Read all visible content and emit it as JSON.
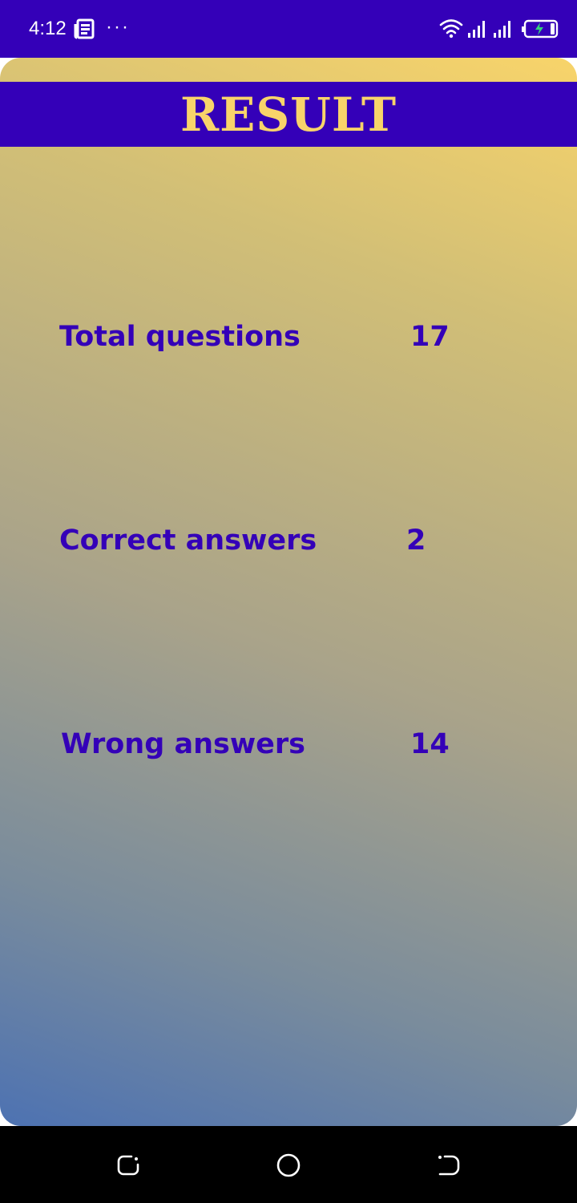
{
  "status_bar": {
    "time": "4:12",
    "icons": [
      "news-icon",
      "more-dots-icon",
      "wifi-icon",
      "signal-icon",
      "signal-icon",
      "battery-charging-icon"
    ],
    "more_glyph": "···",
    "background": "#3400b8"
  },
  "result": {
    "title": "RESULT",
    "rows": [
      {
        "label": "Total questions",
        "value": "17"
      },
      {
        "label": "Correct answers",
        "value": "2"
      },
      {
        "label": "Wrong answers",
        "value": "14"
      }
    ]
  },
  "colors": {
    "accent": "#3400b8",
    "title_text": "#f8d46a",
    "gradient_top": "#f8d46a",
    "gradient_bottom": "#4d72b2"
  },
  "nav_bar": {
    "icons": [
      "recents-icon",
      "home-icon",
      "back-icon"
    ]
  }
}
